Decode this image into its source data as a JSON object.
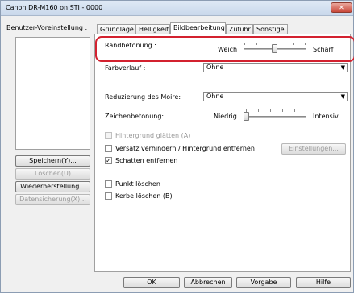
{
  "window": {
    "title": "Canon DR-M160 on STI - 0000",
    "close_label": "✕"
  },
  "left": {
    "preset_label": "Benutzer-Voreinstellung :",
    "buttons": {
      "save": "Speichern(Y)...",
      "delete": "Löschen(U)",
      "restore": "Wiederherstellung...",
      "backup": "Datensicherung(X)..."
    }
  },
  "tabs": [
    {
      "label": "Grundlage"
    },
    {
      "label": "Helligkeit"
    },
    {
      "label": "Bildbearbeitung"
    },
    {
      "label": "Zufuhr"
    },
    {
      "label": "Sonstige"
    }
  ],
  "panel": {
    "edge": {
      "label": "Randbetonung :",
      "min_label": "Weich",
      "max_label": "Scharf",
      "level": 0.5
    },
    "gradient": {
      "label": "Farbverlauf :",
      "value": "Ohne"
    },
    "moire": {
      "label": "Reduzierung des Moire:",
      "value": "Ohne"
    },
    "char": {
      "label": "Zeichenbetonung:",
      "min_label": "Niedrig",
      "max_label": "Intensiv",
      "level": 0.0
    },
    "checks": {
      "smooth_bg": {
        "label": "Hintergrund glätten (A)",
        "checked": false,
        "enabled": false
      },
      "bleed": {
        "label": "Versatz verhindern / Hintergrund entfernen",
        "checked": false,
        "enabled": true
      },
      "shadow": {
        "label": "Schatten entfernen",
        "checked": true,
        "enabled": true
      },
      "punch": {
        "label": "Punkt löschen",
        "checked": false,
        "enabled": true
      },
      "notch": {
        "label": "Kerbe löschen (B)",
        "checked": false,
        "enabled": true
      }
    },
    "settings_button": "Einstellungen..."
  },
  "footer": {
    "ok": "OK",
    "cancel": "Abbrechen",
    "default": "Vorgabe",
    "help": "Hilfe"
  },
  "colors": {
    "highlight": "#d3212f"
  }
}
